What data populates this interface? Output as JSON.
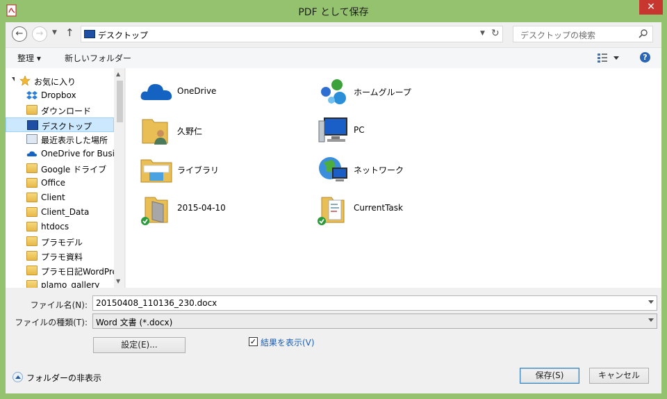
{
  "window": {
    "title": "PDF として保存",
    "close_glyph": "✕"
  },
  "address_bar": {
    "path": "デスクトップ",
    "search_placeholder": "デスクトップの検索"
  },
  "toolbar": {
    "organize": "整理 ▾",
    "new_folder": "新しいフォルダー"
  },
  "nav_pane": {
    "items": [
      {
        "label": "お気に入り",
        "icon": "star-icon"
      },
      {
        "label": "Dropbox",
        "icon": "dropbox-icon"
      },
      {
        "label": "ダウンロード",
        "icon": "downloads-folder-icon"
      },
      {
        "label": "デスクトップ",
        "icon": "desktop-icon"
      },
      {
        "label": "最近表示した場所",
        "icon": "recent-places-icon"
      },
      {
        "label": "OneDrive for Business",
        "icon": "onedrive-icon"
      },
      {
        "label": "Google ドライブ",
        "icon": "google-drive-folder-icon"
      },
      {
        "label": "Office",
        "icon": "folder-icon"
      },
      {
        "label": "Client",
        "icon": "folder-icon"
      },
      {
        "label": "Client_Data",
        "icon": "folder-icon"
      },
      {
        "label": "htdocs",
        "icon": "folder-icon"
      },
      {
        "label": "プラモデル",
        "icon": "folder-icon"
      },
      {
        "label": "プラモ資料",
        "icon": "folder-icon"
      },
      {
        "label": "プラモ日記WordPress",
        "icon": "folder-icon"
      },
      {
        "label": "plamo_gallery",
        "icon": "folder-icon"
      }
    ],
    "selected_label": "デスクトップ"
  },
  "content": {
    "items": [
      {
        "name": "OneDrive",
        "icon": "onedrive-cloud-icon"
      },
      {
        "name": "ホームグループ",
        "icon": "homegroup-icon"
      },
      {
        "name": "久野仁",
        "icon": "user-folder-icon"
      },
      {
        "name": "PC",
        "icon": "pc-icon"
      },
      {
        "name": "ライブラリ",
        "icon": "libraries-icon"
      },
      {
        "name": "ネットワーク",
        "icon": "network-icon"
      },
      {
        "name": "2015-04-10",
        "icon": "synced-folder-icon"
      },
      {
        "name": "CurrentTask",
        "icon": "synced-document-folder-icon"
      }
    ]
  },
  "form": {
    "filename_label": "ファイル名(N):",
    "filename_value": "20150408_110136_230.docx",
    "filetype_label": "ファイルの種類(T):",
    "filetype_value": "Word 文書 (*.docx)",
    "settings_button": "設定(E)...",
    "show_result_label": "結果を表示(V)",
    "show_result_checked": true,
    "hide_folders": "フォルダーの非表示",
    "save_button": "保存(S)",
    "cancel_button": "キャンセル"
  },
  "colors": {
    "frame": "#95c26f",
    "close": "#c7372f",
    "selection": "#cce8ff"
  }
}
